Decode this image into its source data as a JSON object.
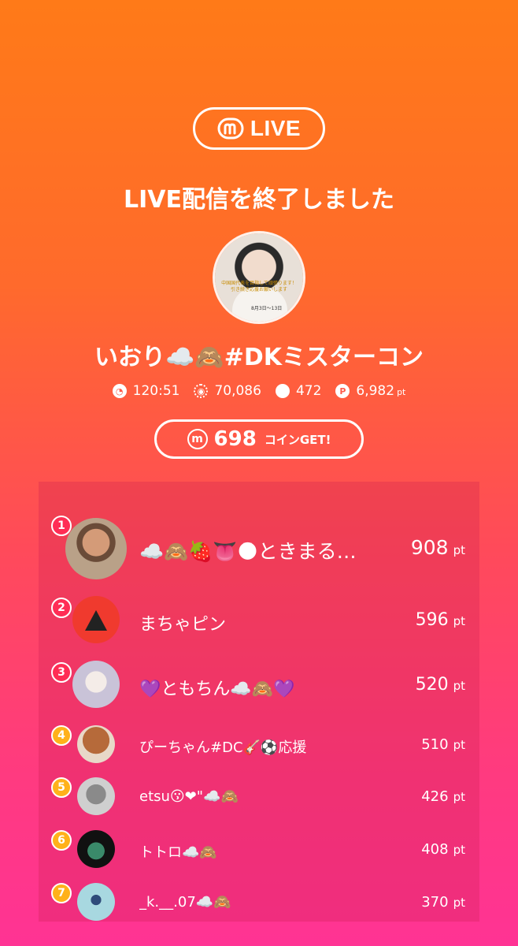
{
  "badge": {
    "label": "LIVE"
  },
  "title": "LIVE配信を終了しました",
  "streamer": {
    "name": "いおり☁️🙈#DKミスターコン"
  },
  "stats": {
    "duration": "120:51",
    "views": "70,086",
    "comments": "472",
    "points": "6,982",
    "points_unit": "pt"
  },
  "coins": {
    "amount": "698",
    "label": "コインGET!"
  },
  "ranking": [
    {
      "rank": "1",
      "name": "☁️🙈🍓👅🌑ときまる…",
      "points": "908",
      "unit": "pt"
    },
    {
      "rank": "2",
      "name": "まちゃピン",
      "points": "596",
      "unit": "pt"
    },
    {
      "rank": "3",
      "name": "💜ともちん☁️🙈💜",
      "points": "520",
      "unit": "pt"
    },
    {
      "rank": "4",
      "name": "ぴーちゃん#DC🎸⚽応援",
      "points": "510",
      "unit": "pt"
    },
    {
      "rank": "5",
      "name": "etsu😗❤\"☁️🙈",
      "points": "426",
      "unit": "pt"
    },
    {
      "rank": "6",
      "name": "トトロ☁️🙈",
      "points": "408",
      "unit": "pt"
    },
    {
      "rank": "7",
      "name": "_k.__.07☁️🙈",
      "points": "370",
      "unit": "pt"
    }
  ],
  "colors": {
    "accent": "#ff5a4a",
    "rank_top": "#ff2d55",
    "rank_other": "#ffb11a"
  }
}
